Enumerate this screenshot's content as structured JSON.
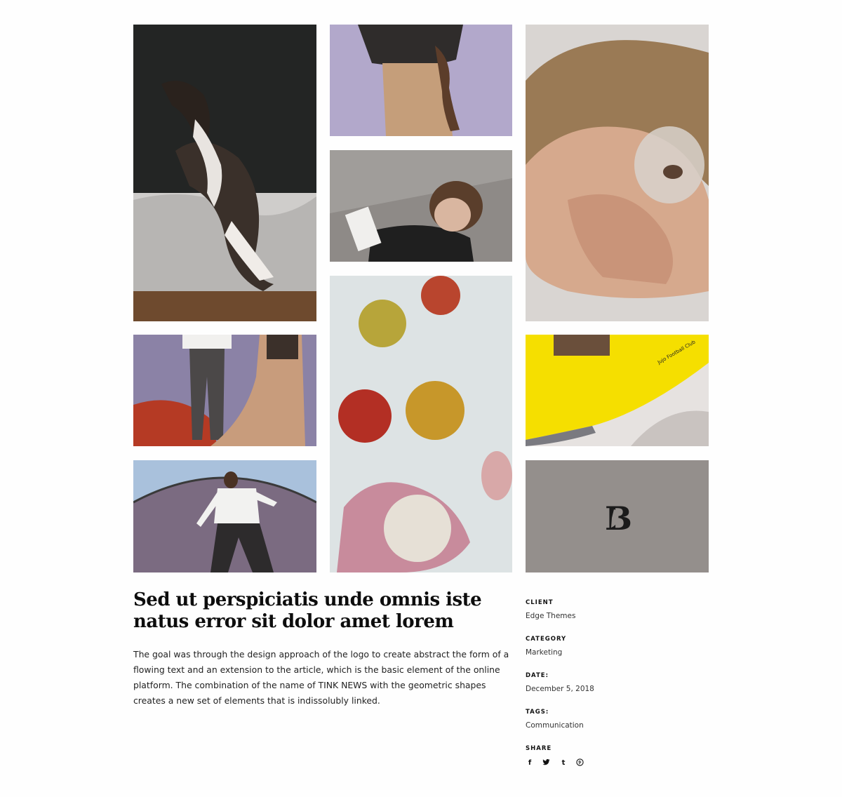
{
  "gallery": [
    {
      "name": "dog-photo"
    },
    {
      "name": "shirt-photo"
    },
    {
      "name": "boy-photo"
    },
    {
      "name": "eye-photo"
    },
    {
      "name": "legs-photo"
    },
    {
      "name": "lychee-photo"
    },
    {
      "name": "magazine-photo"
    },
    {
      "name": "man-photo"
    },
    {
      "name": "logo-tile"
    }
  ],
  "magazine_text": "Jujo Football Club",
  "logo_letter": "B",
  "project": {
    "title": "Sed ut perspiciatis unde omnis iste natus error sit dolor amet lorem",
    "description": "The goal was through the design approach of the logo to create abstract the form of a flowing text and an extension to the article, which is the basic element of the online platform. The combination of the name of TINK NEWS with the geometric shapes creates a new set of elements that is indissolubly linked."
  },
  "meta": {
    "client_label": "CLIENT",
    "client_value": "Edge Themes",
    "category_label": "CATEGORY",
    "category_value": "Marketing",
    "date_label": "DATE:",
    "date_value": "December 5, 2018",
    "tags_label": "TAGS:",
    "tags_value": "Communication",
    "share_label": "SHARE"
  },
  "share_icons": [
    "facebook-icon",
    "twitter-icon",
    "tumblr-icon",
    "pinterest-icon"
  ],
  "colors": {
    "logo_bg": "#948f8c",
    "magazine_yellow": "#f5df00"
  }
}
